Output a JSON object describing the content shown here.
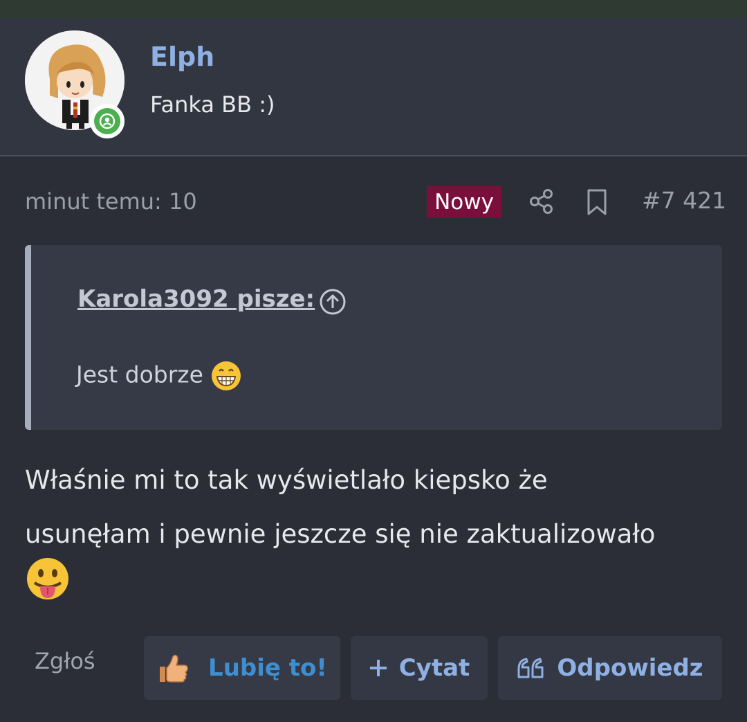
{
  "user": {
    "name": "Elph",
    "title": "Fanka BB :)",
    "avatar_icon": "cartoon-girl-avatar",
    "status_icon": "online-user-icon"
  },
  "post": {
    "time_ago": "minut temu: 10",
    "new_badge": "Nowy",
    "number": "#7 421",
    "share_icon": "share-icon",
    "bookmark_icon": "bookmark-icon"
  },
  "quote": {
    "author": "Karola3092 pisze:",
    "text": "Jest dobrze",
    "emoji": "grinning-face-emoji"
  },
  "message": {
    "line1": "Właśnie mi to tak wyświetlało kiepsko że",
    "line2": "usunęłam i pewnie jeszcze się nie zaktualizowało",
    "emoji": "tongue-face-emoji"
  },
  "actions": {
    "report": "Zgłoś",
    "like": "Lubię to!",
    "quote": "Cytat",
    "reply": "Odpowiedz"
  },
  "colors": {
    "background": "#2b2e37",
    "username": "#8fb0e2",
    "new_badge": "#7a0f3b",
    "like_label": "#3f8fd0",
    "online": "#4cae4f"
  }
}
